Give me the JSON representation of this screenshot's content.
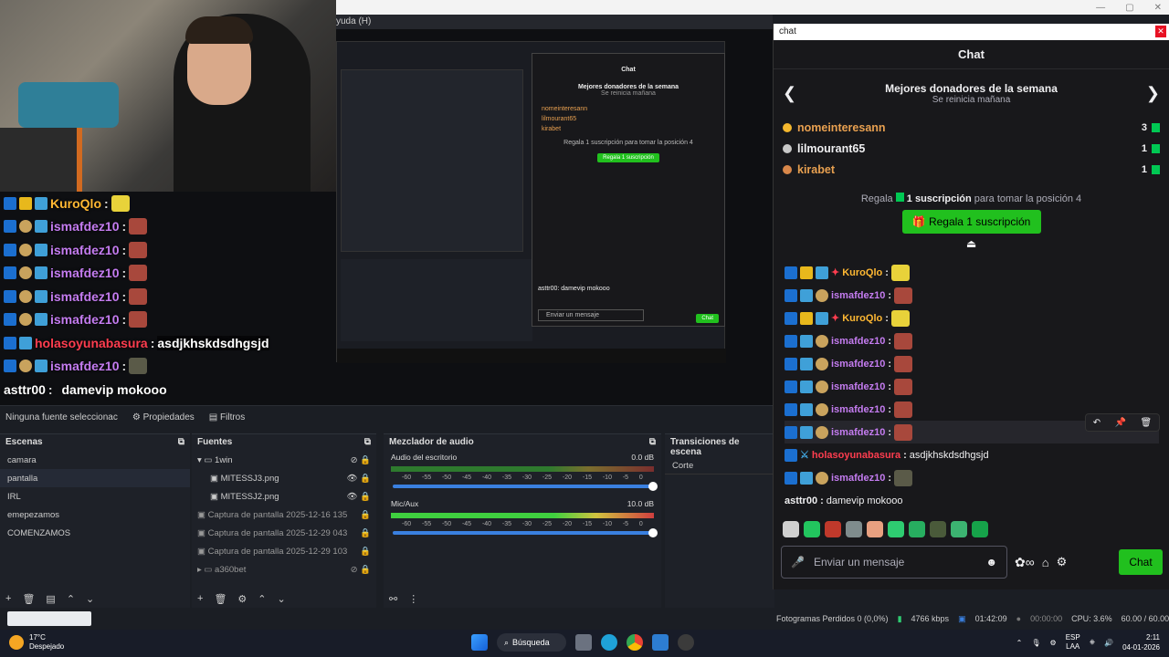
{
  "window": {
    "menu_fragment": "yuda (H)"
  },
  "overlay": {
    "rows": [
      {
        "user": "KuroQlo",
        "color": "#ffb833",
        "sep": " :",
        "text": ""
      },
      {
        "user": "ismafdez10",
        "color": "#c47cf0",
        "sep": " :",
        "text": ""
      },
      {
        "user": "ismafdez10",
        "color": "#c47cf0",
        "sep": " :",
        "text": ""
      },
      {
        "user": "ismafdez10",
        "color": "#c47cf0",
        "sep": " :",
        "text": ""
      },
      {
        "user": "ismafdez10",
        "color": "#c47cf0",
        "sep": " :",
        "text": ""
      },
      {
        "user": "ismafdez10",
        "color": "#c47cf0",
        "sep": " :",
        "text": ""
      },
      {
        "user": "holasoyunabasura",
        "color": "#ff3d4f",
        "sep": " :",
        "text": "asdjkhskdsdhgsjd"
      },
      {
        "user": "ismafdez10",
        "color": "#c47cf0",
        "sep": " :",
        "text": ""
      },
      {
        "user": "asttr00",
        "color": "#ffffff",
        "sep": " :",
        "text": "damevip mokooo"
      }
    ]
  },
  "preview": {
    "no_source": "Ninguna fuente seleccionac",
    "properties": "Propiedades",
    "filters": "Filtros",
    "mini": {
      "chat_title": "Chat",
      "lb_title": "Mejores donadores de la semana",
      "lb_sub": "Se reinicia mañana",
      "donors": [
        "nomeinteresann",
        "lilmourant65",
        "kirabet"
      ],
      "gift_line": "Regala 1 suscripción para tomar la posición 4",
      "gift_btn": "Regala 1 suscripción",
      "last_msg": "asttr00: damevip mokooo",
      "input": "Enviar un mensaje",
      "chat_btn": "Chat"
    }
  },
  "scenes": {
    "title": "Escenas",
    "items": [
      "camara",
      "pantalla",
      "IRL",
      "emepezamos",
      "COMENZAMOS"
    ],
    "selected": 1
  },
  "sources": {
    "title": "Fuentes",
    "items": [
      "1win",
      "MITESSJ3.png",
      "MITESSJ2.png",
      "Captura de pantalla 2025-12-16 135",
      "Captura de pantalla 2025-12-29 043",
      "Captura de pantalla 2025-12-29 103",
      "a360bet"
    ]
  },
  "mixer": {
    "title": "Mezclador de audio",
    "channels": [
      {
        "name": "Audio del escritorio",
        "db": "0.0 dB"
      },
      {
        "name": "Mic/Aux",
        "db": "10.0 dB"
      }
    ],
    "scale": [
      "-60",
      "-55",
      "-50",
      "-45",
      "-40",
      "-35",
      "-30",
      "-25",
      "-20",
      "-15",
      "-10",
      "-5",
      "0"
    ]
  },
  "transitions": {
    "title": "Transiciones de escena",
    "value": "Corte"
  },
  "chat": {
    "window_title": "chat",
    "header": "Chat",
    "lb_title": "Mejores donadores de la semana",
    "lb_sub": "Se reinicia mañana",
    "donors": [
      {
        "name": "nomeinteresann",
        "count": "3",
        "rank_color": "#f5b82e"
      },
      {
        "name": "lilmourant65",
        "count": "1",
        "rank_color": "#c8c8c8"
      },
      {
        "name": "kirabet",
        "count": "1",
        "rank_color": "#d9874a"
      }
    ],
    "gift_line_a": "Regala",
    "gift_line_b": "1 suscripción",
    "gift_line_c": "para tomar la posición 4",
    "gift_btn": "Regala 1 suscripción",
    "messages": [
      {
        "user": "KuroQlo",
        "color": "#ffb833",
        "text": ""
      },
      {
        "user": "ismafdez10",
        "color": "#c47cf0",
        "text": ""
      },
      {
        "user": "KuroQlo",
        "color": "#ffb833",
        "text": ""
      },
      {
        "user": "ismafdez10",
        "color": "#c47cf0",
        "text": ""
      },
      {
        "user": "ismafdez10",
        "color": "#c47cf0",
        "text": ""
      },
      {
        "user": "ismafdez10",
        "color": "#c47cf0",
        "text": ""
      },
      {
        "user": "ismafdez10",
        "color": "#c47cf0",
        "text": ""
      },
      {
        "user": "ismafdez10",
        "color": "#c47cf0",
        "text": ""
      },
      {
        "user": "holasoyunabasura",
        "color": "#ff3d4f",
        "text": "asdjkhskdsdhgsjd"
      },
      {
        "user": "ismafdez10",
        "color": "#c47cf0",
        "text": ""
      },
      {
        "user": "asttr00",
        "color": "#efeff1",
        "text": "damevip mokooo"
      }
    ],
    "input_placeholder": "Enviar un mensaje",
    "chat_btn": "Chat"
  },
  "obs_status": {
    "dropped": "Fotogramas Perdidos 0 (0,0%)",
    "kbps": "4766 kbps",
    "time1": "01:42:09",
    "time2": "00:00:00",
    "cpu": "CPU: 3.6%",
    "fps": "60.00 / 60.00 FPS"
  },
  "taskbar": {
    "temp": "17°C",
    "weather": "Despejado",
    "search": "Búsqueda",
    "lang1": "ESP",
    "lang2": "LAA",
    "time": "2:11",
    "date": "04-01-2026"
  }
}
